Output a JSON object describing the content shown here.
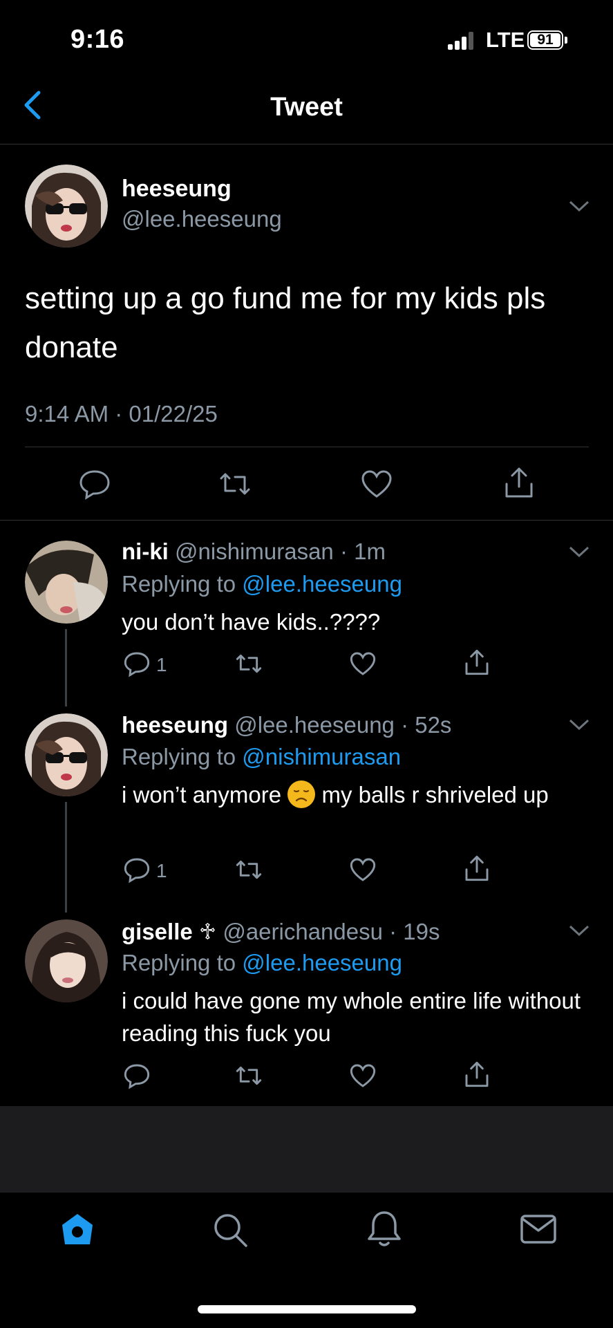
{
  "status_bar": {
    "time": "9:16",
    "network": "LTE",
    "battery": "91"
  },
  "header": {
    "title": "Tweet"
  },
  "tweet": {
    "name": "heeseung",
    "handle": "@lee.heeseung",
    "text": "setting up a go fund me for my kids pls donate",
    "timestamp": "9:14 AM · 01/22/25"
  },
  "replies": [
    {
      "name": "ni-ki",
      "meta": "@nishimurasan · 1m",
      "replying_prefix": "Replying to",
      "replying_to": "@lee.heeseung",
      "text": "you don’t have kids..????",
      "reply_count": "1"
    },
    {
      "name": "heeseung",
      "meta": "@lee.heeseung · 52s",
      "replying_prefix": "Replying to",
      "replying_to": "@nishimurasan",
      "text_before_emoji": "i won’t anymore",
      "emoji": "disappointed-face",
      "text_after_emoji": "my balls r shriveled up",
      "reply_count": "1"
    },
    {
      "name": "giselle ♱",
      "meta": "@aerichandesu · 19s",
      "replying_prefix": "Replying to",
      "replying_to": "@lee.heeseung",
      "text": "i could have gone my whole entire life without reading this fuck you",
      "reply_count": ""
    }
  ],
  "colors": {
    "accent": "#1d9bf0",
    "secondary_text": "#8b98a5",
    "background": "#000000"
  },
  "tabbar": [
    "home-icon",
    "search-icon",
    "bell-icon",
    "mail-icon"
  ]
}
